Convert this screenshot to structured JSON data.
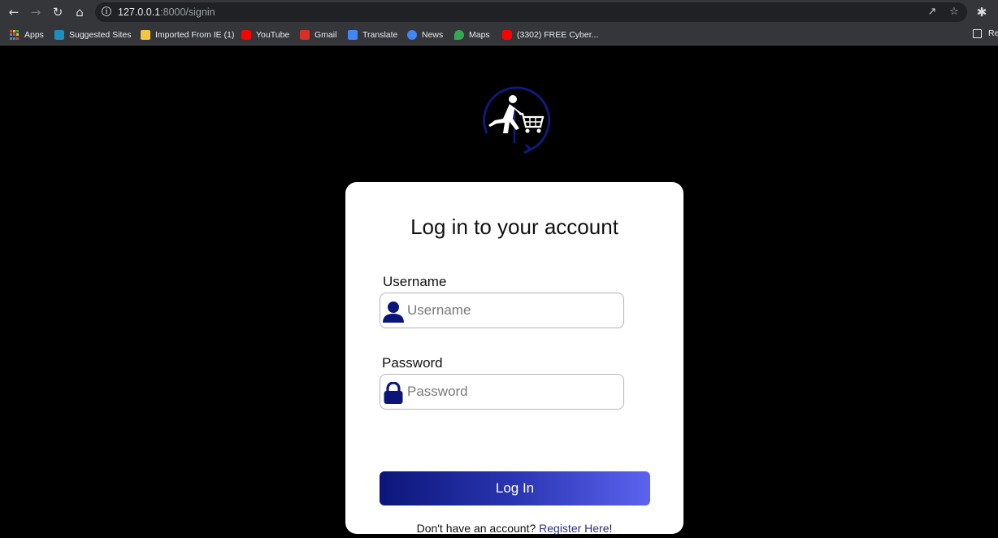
{
  "browser": {
    "url_host": "127.0.0.1",
    "url_path": ":8000/signin",
    "bookmarks": [
      {
        "label": "Apps",
        "color": "#e8eaed"
      },
      {
        "label": "Suggested Sites",
        "color": "#1b8fbf"
      },
      {
        "label": "Imported From IE (1)",
        "color": "#f4c542"
      },
      {
        "label": "YouTube",
        "color": "#ff0000"
      },
      {
        "label": "Gmail",
        "color": "#d93025"
      },
      {
        "label": "Translate",
        "color": "#4285f4"
      },
      {
        "label": "News",
        "color": "#4285f4"
      },
      {
        "label": "Maps",
        "color": "#34a853"
      },
      {
        "label": "(3302) FREE Cyber...",
        "color": "#ff0000"
      }
    ],
    "reading_list_label": "Re"
  },
  "card": {
    "title": "Log in to your account",
    "username_label": "Username",
    "username_placeholder": "Username",
    "password_label": "Password",
    "password_placeholder": "Password",
    "login_label": "Log In",
    "register_prompt": "Don't have an account?",
    "register_link": "Register Here",
    "register_suffix": "!"
  },
  "colors": {
    "accent": "#0c1679",
    "accent_end": "#5c63ef",
    "page_background": "#000000",
    "card_background": "#ffffff"
  }
}
